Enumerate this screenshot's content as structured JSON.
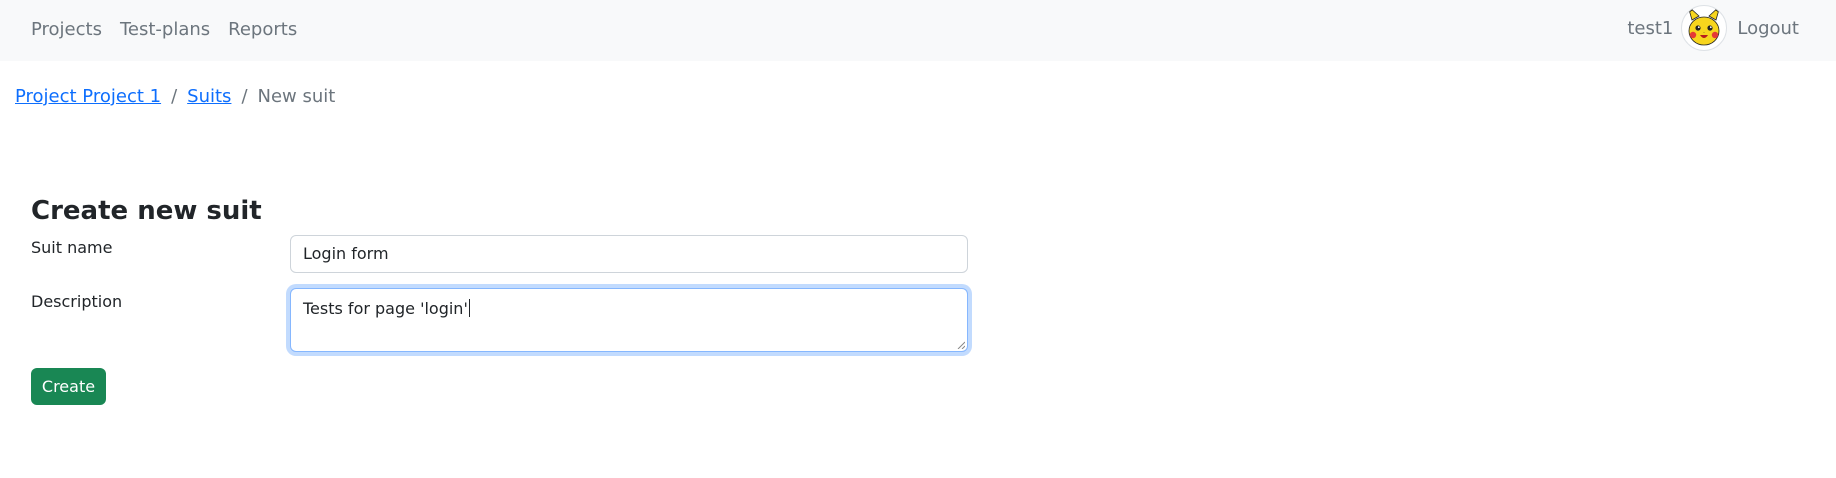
{
  "nav": {
    "links": [
      "Projects",
      "Test-plans",
      "Reports"
    ],
    "username": "test1",
    "avatar_icon": "pikachu-avatar-icon",
    "logout_label": "Logout"
  },
  "breadcrumb": {
    "project": "Project Project 1",
    "suits": "Suits",
    "current": "New suit",
    "separator": "/"
  },
  "form": {
    "title": "Create new suit",
    "suit_name_label": "Suit name",
    "suit_name_value": "Login form",
    "description_label": "Description",
    "description_value": "Tests for page 'login'",
    "create_label": "Create"
  },
  "colors": {
    "navbar_bg": "#f8f9fa",
    "link": "#0d6efd",
    "muted": "#6c757d",
    "primary_button": "#198754",
    "focus_border": "#86b7fe"
  }
}
